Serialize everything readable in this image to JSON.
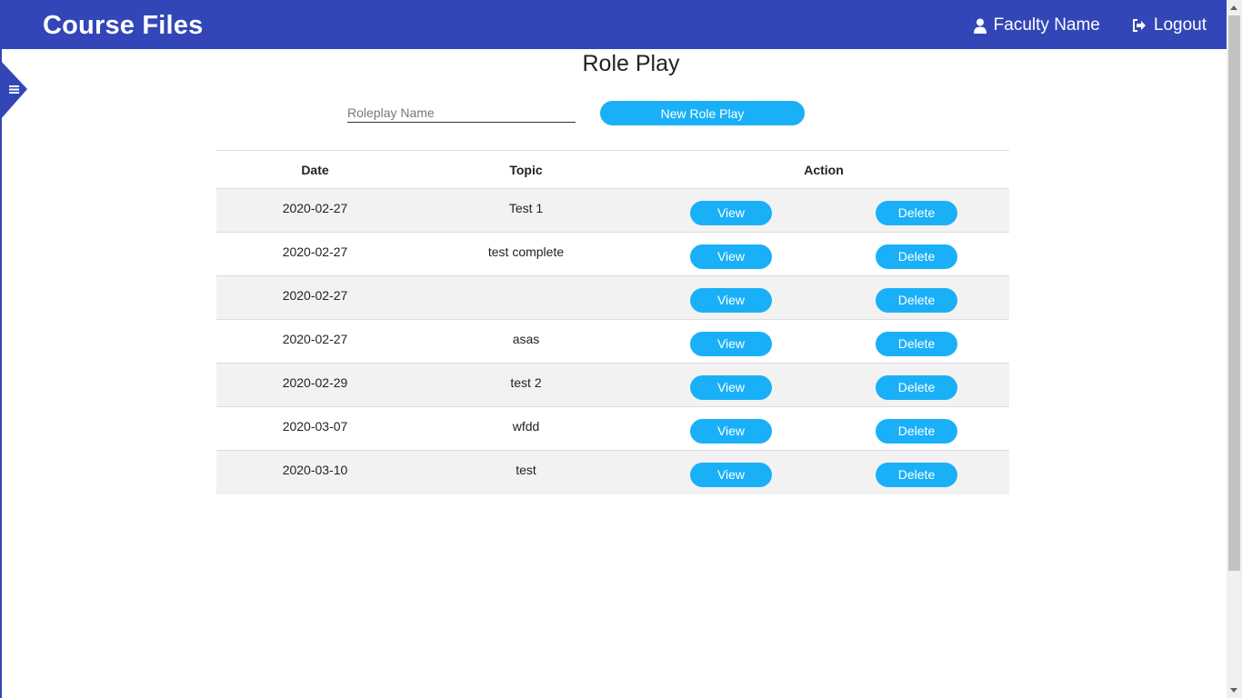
{
  "header": {
    "brand": "Course Files",
    "user_label": "Faculty Name",
    "logout_label": "Logout",
    "color": "#3346b7"
  },
  "main": {
    "title": "Role Play",
    "input_placeholder": "Roleplay Name",
    "input_value": "",
    "new_button_label": "New Role Play"
  },
  "table": {
    "headers": {
      "date": "Date",
      "topic": "Topic",
      "action": "Action"
    },
    "rows": [
      {
        "date": "2020-02-27",
        "topic": "Test 1",
        "view": "View",
        "delete": "Delete"
      },
      {
        "date": "2020-02-27",
        "topic": "test complete",
        "view": "View",
        "delete": "Delete"
      },
      {
        "date": "2020-02-27",
        "topic": "",
        "view": "View",
        "delete": "Delete"
      },
      {
        "date": "2020-02-27",
        "topic": "asas",
        "view": "View",
        "delete": "Delete"
      },
      {
        "date": "2020-02-29",
        "topic": "test 2",
        "view": "View",
        "delete": "Delete"
      },
      {
        "date": "2020-03-07",
        "topic": "wfdd",
        "view": "View",
        "delete": "Delete"
      },
      {
        "date": "2020-03-10",
        "topic": "test",
        "view": "View",
        "delete": "Delete"
      }
    ]
  },
  "icons": {
    "user": "user-icon",
    "logout": "logout-icon",
    "menu": "hamburger-menu-icon"
  },
  "accent_color": "#1ab0f7"
}
